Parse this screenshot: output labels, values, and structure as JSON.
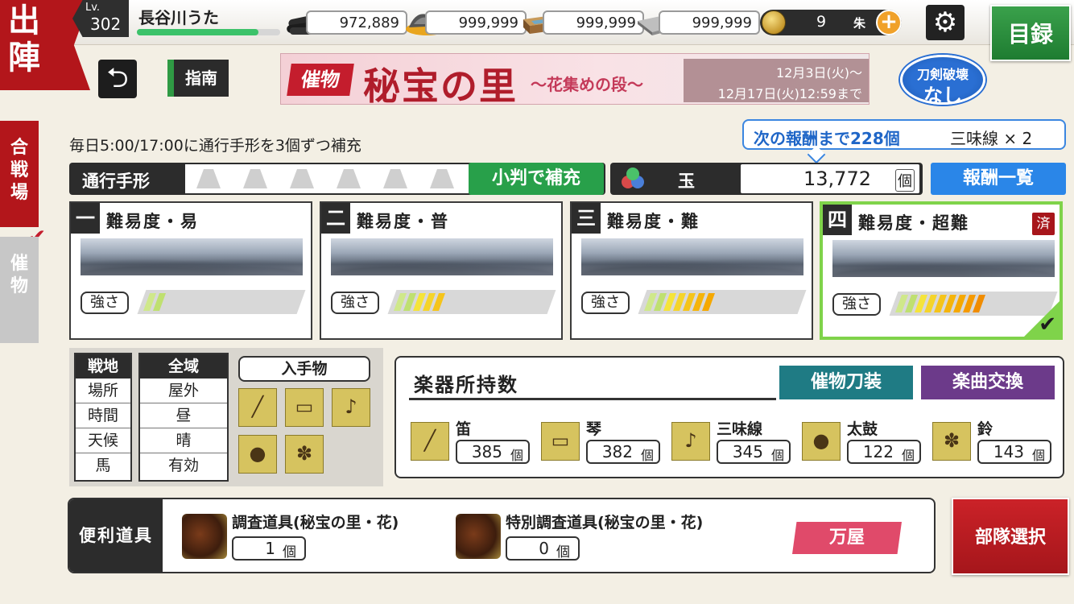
{
  "header": {
    "side_title_1": "出",
    "side_title_2": "陣",
    "level_label": "Lv.",
    "level": "302",
    "player_name": "長谷川うた",
    "exp_fraction": 0.85,
    "resources": [
      {
        "icon": "charcoal-icon",
        "value": "972,889"
      },
      {
        "icon": "tamahagane-icon",
        "value": "999,999"
      },
      {
        "icon": "cooling-material-icon",
        "value": "999,999"
      },
      {
        "icon": "whetstone-icon",
        "value": "999,999"
      }
    ],
    "koban": {
      "value": "9",
      "unit": "朱",
      "plus": "+"
    },
    "catalog_button": "目録"
  },
  "toolbar2": {
    "back_icon": "undo-arrow-icon",
    "guide_button": "指南",
    "banner": {
      "tag": "催物",
      "title": "秘宝の里",
      "subtitle": "～花集めの段～",
      "date_start": "12月3日(火)～",
      "date_end": "12月17日(火)12:59まで"
    },
    "no_break": {
      "line1": "刀剣破壊",
      "line2": "なし"
    }
  },
  "left_tabs": [
    {
      "label": "合戦場",
      "active": true
    },
    {
      "label": "催物",
      "active": false
    }
  ],
  "info": {
    "daily_text": "毎日5:00/17:00に通行手形を3個ずつ補充",
    "next_reward_text": "次の報酬まで228個",
    "next_reward_item": "三味線 × 2",
    "pass_label": "通行手形",
    "pass_slots_total": 6,
    "koban_refill_button": "小判で補充",
    "tama_label": "玉",
    "tama_value": "13,772",
    "tama_unit": "個",
    "reward_list_button": "報酬一覧"
  },
  "difficulties": [
    {
      "num": "一",
      "title": "難易度・易",
      "strength_label": "強さ",
      "level": 2,
      "done": false,
      "selected": false
    },
    {
      "num": "二",
      "title": "難易度・普",
      "strength_label": "強さ",
      "level": 5,
      "done": false,
      "selected": false
    },
    {
      "num": "三",
      "title": "難易度・難",
      "strength_label": "強さ",
      "level": 7,
      "done": false,
      "selected": false
    },
    {
      "num": "四",
      "title": "難易度・超難",
      "strength_label": "強さ",
      "level": 9,
      "done": true,
      "done_label": "済",
      "selected": true
    }
  ],
  "conditions": {
    "col1": [
      "戦地",
      "場所",
      "時間",
      "天候",
      "馬"
    ],
    "col2": [
      "全域",
      "屋外",
      "昼",
      "晴",
      "有効"
    ],
    "loot_label": "入手物",
    "loot_icons": [
      "flute-icon",
      "koto-icon",
      "shamisen-icon",
      "taiko-icon",
      "bell-icon"
    ]
  },
  "instruments": {
    "title": "楽器所持数",
    "katana_button": "催物刀装",
    "exchange_button": "楽曲交換",
    "items": [
      {
        "name": "笛",
        "count": "385",
        "unit": "個",
        "icon": "flute-icon"
      },
      {
        "name": "琴",
        "count": "382",
        "unit": "個",
        "icon": "koto-icon"
      },
      {
        "name": "三味線",
        "count": "345",
        "unit": "個",
        "icon": "shamisen-icon"
      },
      {
        "name": "太鼓",
        "count": "122",
        "unit": "個",
        "icon": "taiko-icon"
      },
      {
        "name": "鈴",
        "count": "143",
        "unit": "個",
        "icon": "bell-icon"
      }
    ]
  },
  "tools": {
    "label": "便利道具",
    "items": [
      {
        "name": "調査道具(秘宝の里・花)",
        "count": "1",
        "unit": "個"
      },
      {
        "name": "特別調査道具(秘宝の里・花)",
        "count": "0",
        "unit": "個"
      }
    ],
    "shop_button": "万屋",
    "team_select_button": "部隊選択"
  }
}
